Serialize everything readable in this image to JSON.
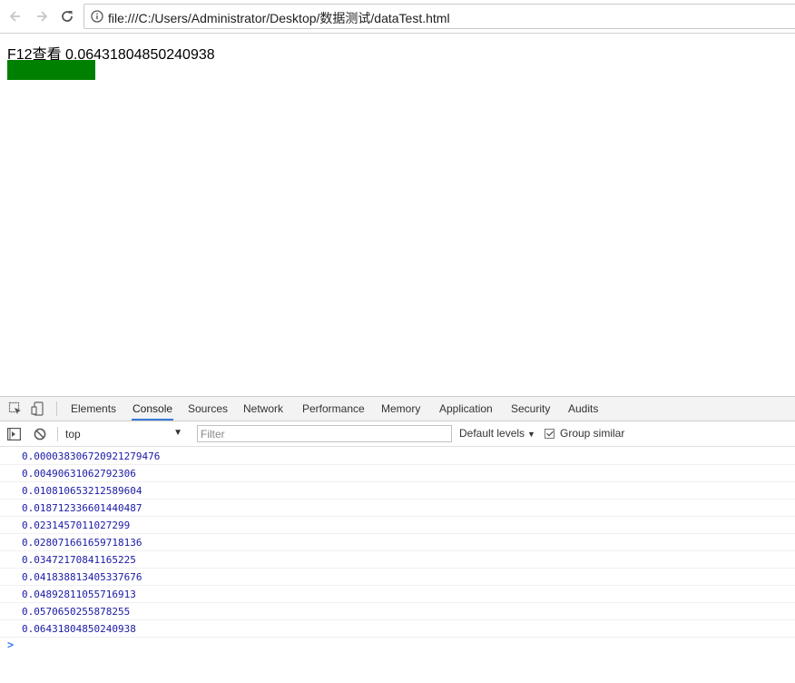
{
  "browser": {
    "url": "file:///C:/Users/Administrator/Desktop/数据测试/dataTest.html"
  },
  "page": {
    "text": "F12查看 0.06431804850240938",
    "bar_color": "#008000"
  },
  "devtools": {
    "tabs": [
      {
        "label": "Elements"
      },
      {
        "label": "Console"
      },
      {
        "label": "Sources"
      },
      {
        "label": "Network"
      },
      {
        "label": "Performance"
      },
      {
        "label": "Memory"
      },
      {
        "label": "Application"
      },
      {
        "label": "Security"
      },
      {
        "label": "Audits"
      }
    ],
    "active_tab": "Console",
    "context": "top",
    "filter_placeholder": "Filter",
    "levels": "Default levels",
    "group_similar": "Group similar",
    "group_similar_checked": true,
    "messages": [
      "0.000038306720921279476",
      "0.00490631062792306",
      "0.010810653212589604",
      "0.018712336601440487",
      "0.0231457011027299",
      "0.028071661659718136",
      "0.03472170841165225",
      "0.041838813405337676",
      "0.04892811055716913",
      "0.0570650255878255",
      "0.06431804850240938"
    ],
    "message_color": "#1a1aa6",
    "accent_color": "#3879d9"
  }
}
